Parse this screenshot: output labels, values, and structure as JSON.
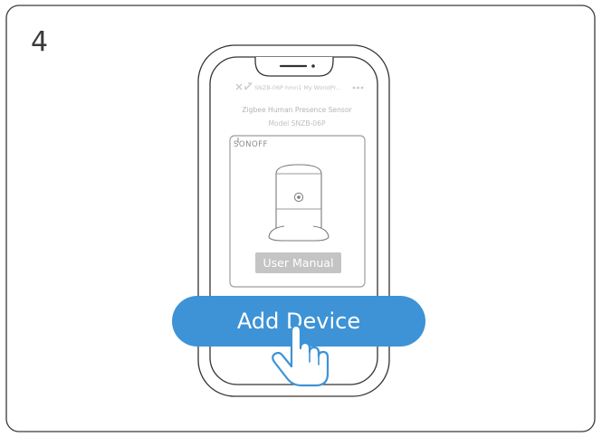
{
  "step": {
    "number": "4"
  },
  "phone": {
    "header": {
      "title": "SNZB-06P hmn1 My WorldPr...",
      "close_icon": "close-icon",
      "expand_icon": "expand-icon",
      "more_icon": "more-icon"
    },
    "device_name": "Zigbee Human Presence Sensor",
    "model": "Model SNZB-06P",
    "card": {
      "brand": "SONOFF",
      "image_icon": "presence-sensor-icon",
      "user_manual_label": "User Manual"
    }
  },
  "callout": {
    "add_device_label": "Add Device",
    "pointer_icon": "tap-hand-icon"
  },
  "colors": {
    "frame": "#3a3a3a",
    "button_blue": "#3d93d6",
    "button_gray": "#c4c4c4",
    "text_light": "#bdbdbd"
  }
}
